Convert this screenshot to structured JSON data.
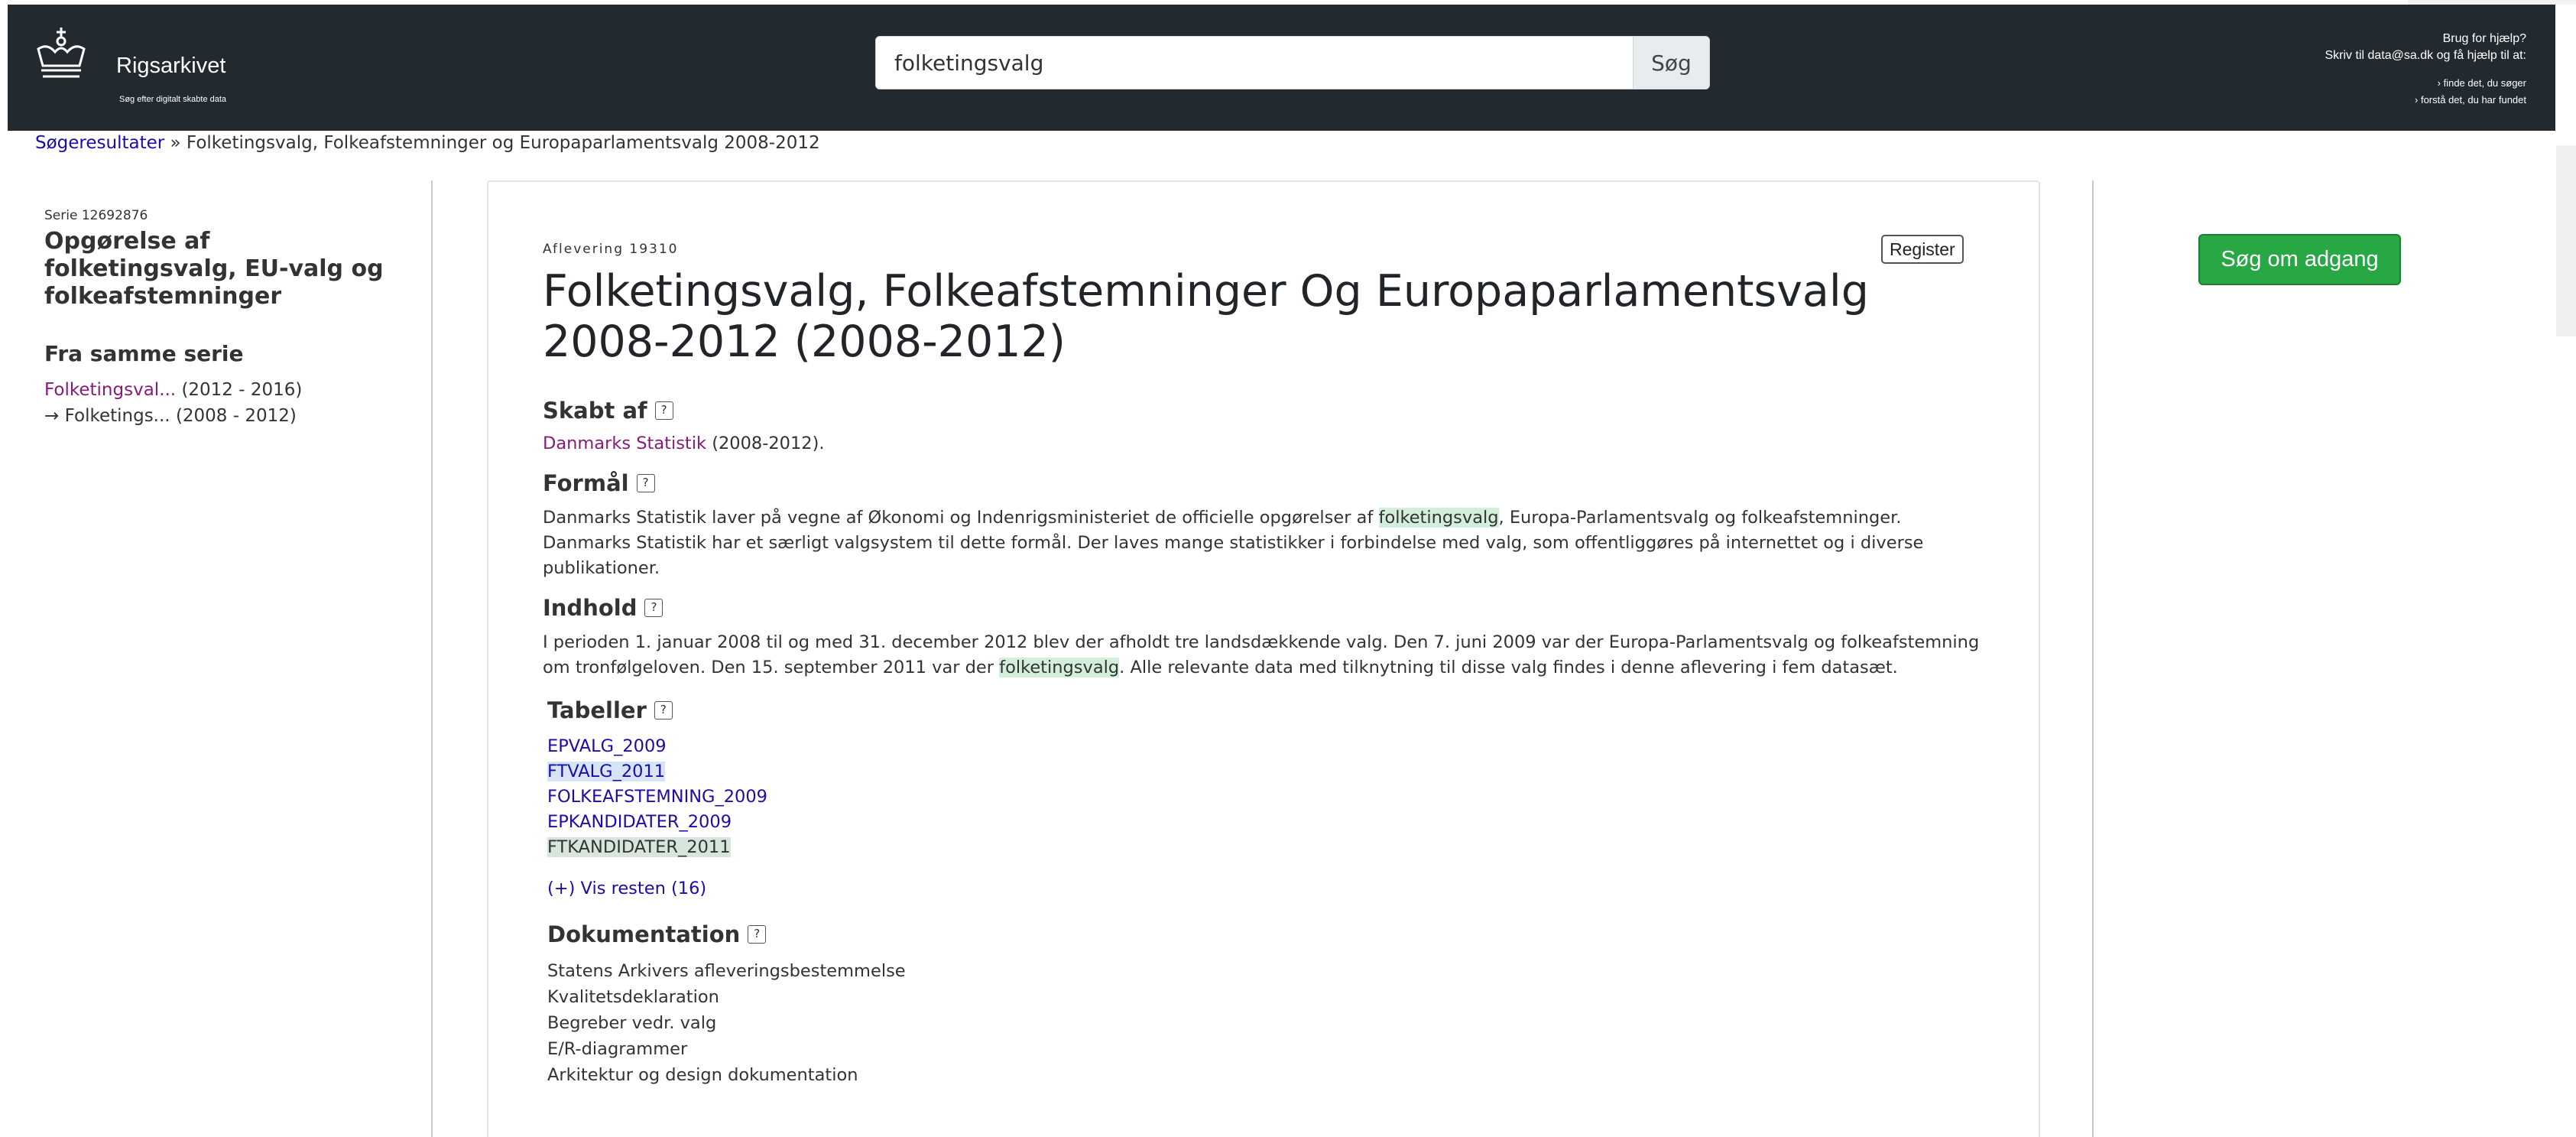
{
  "header": {
    "logo_name": "Rigsarkivet",
    "logo_tagline": "Søg efter digitalt skabte data",
    "search_value": "folketingsvalg",
    "search_button": "Søg",
    "help_title": "Brug for hjælp?",
    "help_prefix": "Skriv til",
    "help_email": "data@sa.dk",
    "help_suffix": "og få hjælp til at:",
    "help_link_1": "› finde det, du søger",
    "help_link_2": "› forstå det, du har fundet"
  },
  "breadcrumb": {
    "link": "Søgeresultater",
    "separator": "»",
    "current": "Folketingsvalg, Folkeafstemninger og Europaparlamentsvalg 2008-2012"
  },
  "sidebar": {
    "series_id": "Serie 12692876",
    "series_title": "Opgørelse af folketingsvalg, EU-valg og folkeafstemninger",
    "same_series_heading": "Fra samme serie",
    "related": [
      {
        "prefix": "",
        "label": "Folketingsval...",
        "years": "(2012 - 2016)"
      },
      {
        "prefix": "→",
        "label": "Folketings...",
        "years": "(2008 - 2012)"
      }
    ]
  },
  "main": {
    "register_button": "Register",
    "delivery_id": "Aflevering 19310",
    "title": "Folketingsvalg, Folkeafstemninger Og Europaparlamentsvalg 2008-2012 (2008-2012)",
    "help_mark": "?",
    "created_by": {
      "heading": "Skabt af",
      "link": "Danmarks Statistik",
      "period": "(2008-2012)."
    },
    "purpose": {
      "heading": "Formål",
      "text_before": "Danmarks Statistik laver på vegne af Økonomi og Indenrigsministeriet de officielle opgørelser af",
      "highlight": "folketingsvalg",
      "text_after": ", Europa-Parlamentsvalg og folkeafstemninger. Danmarks Statistik har et særligt valgsystem til dette formål. Der laves mange statistikker i forbindelse med valg, som offentliggøres på internettet og i diverse publikationer."
    },
    "content": {
      "heading": "Indhold",
      "text_before": "I perioden 1. januar 2008 til og med 31. december 2012 blev der afholdt tre landsdækkende valg. Den 7. juni 2009 var der Europa-Parlamentsvalg og folkeafstemning om tronfølgeloven. Den 15. september 2011 var der",
      "highlight": "folketingsvalg",
      "text_after": ". Alle relevante data med tilknytning til disse valg findes i denne aflevering i fem datasæt."
    },
    "tables": {
      "heading": "Tabeller",
      "items": [
        "EPVALG_2009",
        "FTVALG_2011",
        "FOLKEAFSTEMNING_2009",
        "EPKANDIDATER_2009",
        "FTKANDIDATER_2011"
      ],
      "show_more": "(+) Vis resten (16)"
    },
    "documentation": {
      "heading": "Dokumentation",
      "items": [
        "Statens Arkivers afleveringsbestemmelse",
        "Kvalitetsdeklaration",
        "Begreber vedr. valg",
        "E/R-diagrammer",
        "Arkitektur og design dokumentation"
      ]
    }
  },
  "access_button": "Søg om adgang",
  "colors": {
    "header_bg": "#222a30",
    "link": "#1a0dab",
    "visited_link": "#8a1a7a",
    "highlight": "#d3efd9",
    "access_button": "#28a745"
  }
}
